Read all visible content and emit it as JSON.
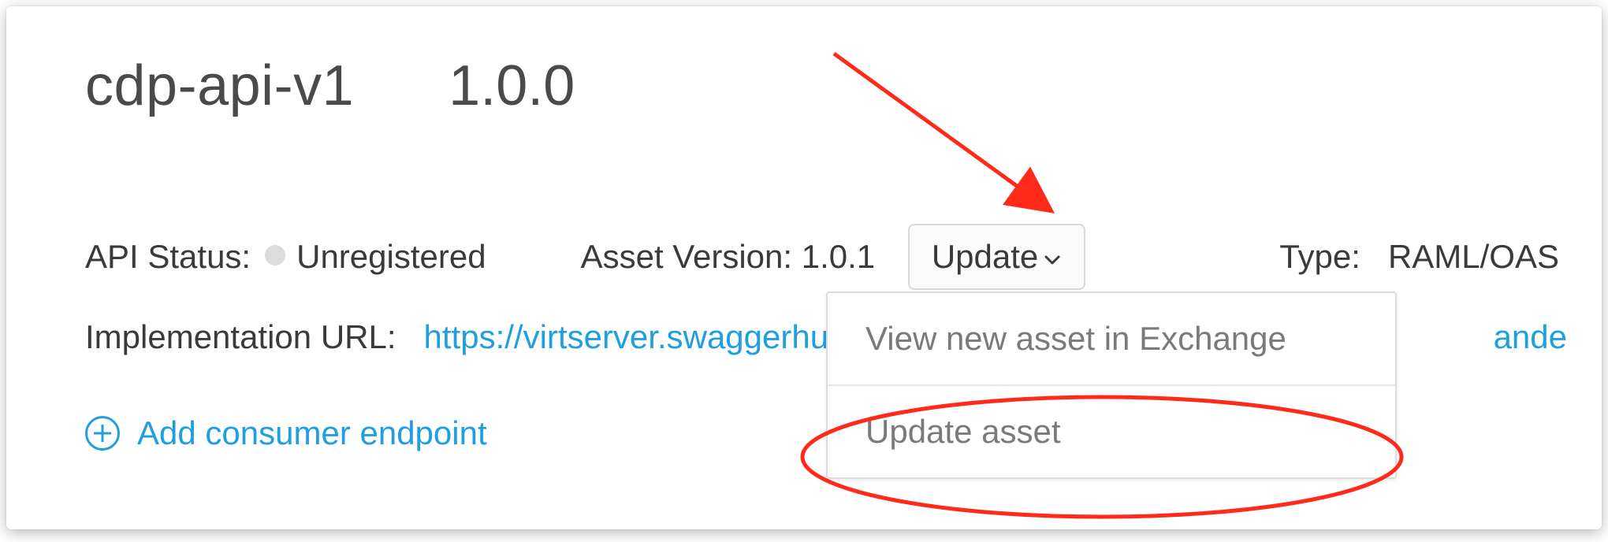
{
  "header": {
    "api_name": "cdp-api-v1",
    "api_version": "1.0.0"
  },
  "status": {
    "label": "API Status:",
    "value": "Unregistered"
  },
  "asset_version": {
    "label": "Asset Version:",
    "value": "1.0.1",
    "update_button": "Update"
  },
  "type": {
    "label": "Type:",
    "value": "RAML/OAS"
  },
  "impl_url": {
    "label": "Implementation URL:",
    "url_visible": "https://virtserver.swaggerhub.c",
    "url_tail": "ande"
  },
  "add_endpoint": {
    "label": "Add consumer endpoint"
  },
  "dropdown": {
    "items": [
      "View new asset in Exchange",
      "Update asset"
    ]
  }
}
